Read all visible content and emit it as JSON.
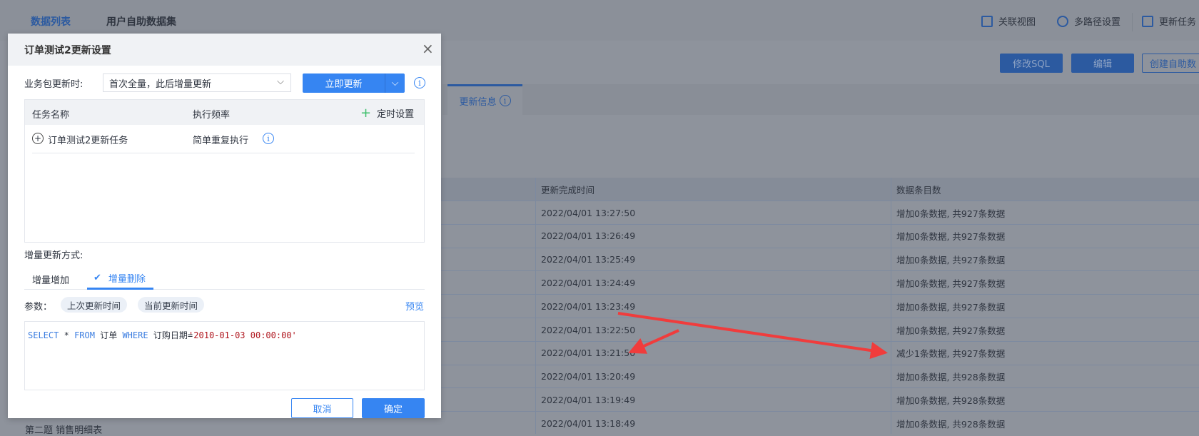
{
  "nav": {
    "tabs": [
      "数据列表",
      "用户自助数据集"
    ],
    "tools": [
      "关联视图",
      "多路径设置",
      "更新任务"
    ]
  },
  "actions": {
    "edit_sql": "修改SQL",
    "edit": "编辑",
    "create": "创建自助数"
  },
  "content_tab": {
    "label": "更新信息"
  },
  "table": {
    "headers": [
      "更新完成时间",
      "数据条目数"
    ],
    "rows": [
      [
        "2022/04/01 13:27:50",
        "增加0条数据, 共927条数据"
      ],
      [
        "2022/04/01 13:26:49",
        "增加0条数据, 共927条数据"
      ],
      [
        "2022/04/01 13:25:49",
        "增加0条数据, 共927条数据"
      ],
      [
        "2022/04/01 13:24:49",
        "增加0条数据, 共927条数据"
      ],
      [
        "2022/04/01 13:23:49",
        "增加0条数据, 共927条数据"
      ],
      [
        "2022/04/01 13:22:50",
        "增加0条数据, 共927条数据"
      ],
      [
        "2022/04/01 13:21:50",
        "减少1条数据, 共927条数据"
      ],
      [
        "2022/04/01 13:20:49",
        "增加0条数据, 共928条数据"
      ],
      [
        "2022/04/01 13:19:49",
        "增加0条数据, 共928条数据"
      ],
      [
        "2022/04/01 13:18:49",
        "增加0条数据, 共928条数据"
      ]
    ]
  },
  "sidebar": {
    "bottom_item": "第二题 销售明细表"
  },
  "dialog": {
    "title": "订单测试2更新设置",
    "update_label": "业务包更新时:",
    "update_mode": "首次全量，此后增量更新",
    "update_now": "立即更新",
    "task_headers": [
      "任务名称",
      "执行频率"
    ],
    "schedule_btn": "定时设置",
    "task": {
      "name": "订单测试2更新任务",
      "freq": "简单重复执行"
    },
    "incr_label": "增量更新方式:",
    "incr_tabs": [
      "增量增加",
      "增量删除"
    ],
    "params_label": "参数：",
    "params": [
      "上次更新时间",
      "当前更新时间"
    ],
    "preview": "预览",
    "sql": {
      "kw1": "SELECT",
      "star": "*",
      "kw2": "FROM",
      "table": "订单",
      "kw3": "WHERE",
      "field": "订购日期=",
      "value": "'2010-01-03 00:00:00'"
    },
    "cancel": "取消",
    "ok": "确定"
  },
  "colors": {
    "primary": "#3685f2",
    "annotation": "#f03c3c"
  }
}
